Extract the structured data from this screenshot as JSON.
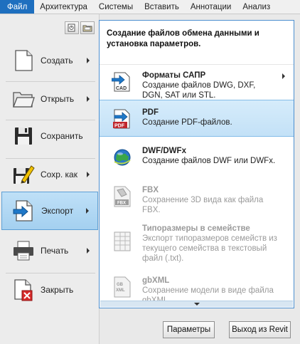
{
  "ribbon": {
    "tabs": [
      "Файл",
      "Архитектура",
      "Системы",
      "Вставить",
      "Аннотации",
      "Анализ"
    ],
    "active_color": "#1e6fbf"
  },
  "app_menu": {
    "items": [
      {
        "label": "Создать",
        "icon": "new-document-icon",
        "has_submenu": true
      },
      {
        "label": "Открыть",
        "icon": "open-folder-icon",
        "has_submenu": true
      },
      {
        "label": "Сохранить",
        "icon": "save-disk-icon",
        "has_submenu": false
      },
      {
        "label": "Сохр. как",
        "icon": "save-as-icon",
        "has_submenu": true
      },
      {
        "label": "Экспорт",
        "icon": "export-icon",
        "has_submenu": true,
        "selected": true
      },
      {
        "label": "Печать",
        "icon": "printer-icon",
        "has_submenu": true
      },
      {
        "label": "Закрыть",
        "icon": "close-document-icon",
        "has_submenu": false
      }
    ]
  },
  "export_menu": {
    "header": "Создание файлов обмена данными и установка параметров.",
    "items": [
      {
        "title": "Форматы САПР",
        "desc": "Создание файлов DWG, DXF, DGN, SAT или STL.",
        "icon": "cad-icon",
        "has_submenu": true,
        "enabled": true
      },
      {
        "title": "PDF",
        "desc": "Создание PDF-файлов.",
        "icon": "pdf-icon",
        "has_submenu": false,
        "enabled": true,
        "highlighted": true
      },
      {
        "title": "DWF/DWFx",
        "desc": "Создание файлов DWF или DWFx.",
        "icon": "dwf-globe-icon",
        "has_submenu": false,
        "enabled": true
      },
      {
        "title": "FBX",
        "desc": "Сохранение 3D вида как файла FBX.",
        "icon": "fbx-icon",
        "has_submenu": false,
        "enabled": false
      },
      {
        "title": "Типоразмеры в семействе",
        "desc": "Экспорт типоразмеров семейств из текущего семейства в текстовый файл (.txt).",
        "icon": "family-types-icon",
        "has_submenu": false,
        "enabled": false
      },
      {
        "title": "gbXML",
        "desc": "Сохранение модели в виде файла gbXML.",
        "icon": "gbxml-icon",
        "has_submenu": false,
        "enabled": false
      }
    ]
  },
  "buttons": {
    "options": "Параметры",
    "exit": "Выход из Revit"
  }
}
